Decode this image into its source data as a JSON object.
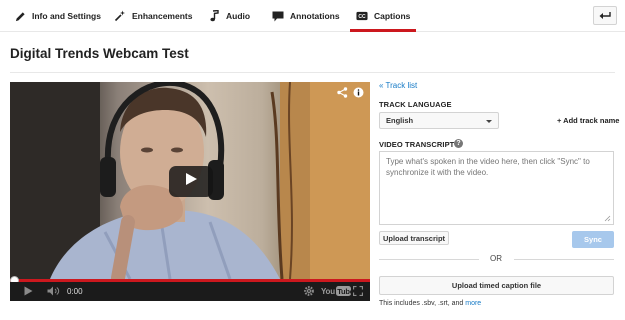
{
  "tabs": [
    {
      "label": "Info and Settings"
    },
    {
      "label": "Enhancements"
    },
    {
      "label": "Audio"
    },
    {
      "label": "Annotations"
    },
    {
      "label": "Captions",
      "active": true
    }
  ],
  "page_title": "Digital Trends Webcam Test",
  "player": {
    "time": "0:00",
    "logo_text": "YouTube",
    "progress_fraction": 1.0
  },
  "captions_panel": {
    "track_list_link": "« Track list",
    "track_language_label": "TRACK LANGUAGE",
    "language_selected": "English",
    "add_track_name": "+ Add track name",
    "video_transcript_label": "VIDEO TRANSCRIPT",
    "help_glyph": "?",
    "transcript_placeholder": "Type what's spoken in the video here, then click \"Sync\" to synchronize it with the video.",
    "upload_transcript_button": "Upload transcript",
    "sync_button": "Sync",
    "or_text": "OR",
    "upload_timed_button": "Upload timed caption file",
    "note_text": "This includes .sbv, .srt, and ",
    "note_link": "more"
  },
  "colors": {
    "accent_red": "#cc181e",
    "link_blue": "#167ac6",
    "sync_disabled_blue": "#a7c8ec"
  },
  "icons": {
    "tab_info": "pencil-icon",
    "tab_enhancements": "magic-wand-icon",
    "tab_audio": "music-note-icon",
    "tab_annotations": "speech-bubble-icon",
    "tab_captions": "cc-icon",
    "back": "return-arrow-icon",
    "share": "share-icon",
    "info": "info-icon",
    "play": "play-icon",
    "volume": "volume-icon",
    "settings": "gear-icon",
    "fullscreen": "fullscreen-icon"
  }
}
